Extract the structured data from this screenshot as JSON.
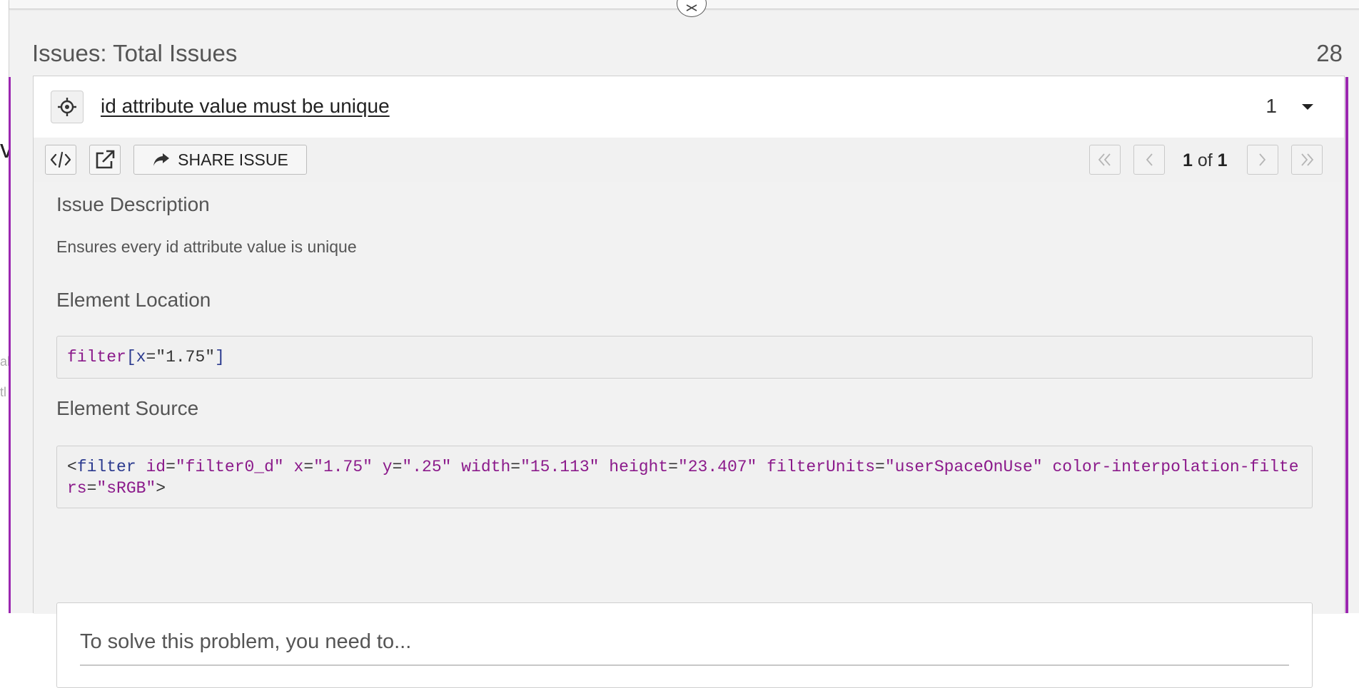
{
  "background": {
    "fragment_large": "vi",
    "fragment_small_1": "al",
    "fragment_small_2": "tl"
  },
  "panel": {
    "close_icon": "close-icon",
    "title": "Issues: Total Issues",
    "total_count": "28"
  },
  "issue": {
    "title": "id attribute value must be unique",
    "count": "1",
    "target_icon": "crosshair-icon",
    "caret_icon": "caret-down-icon"
  },
  "toolbar": {
    "code_icon": "code-icon",
    "open_icon": "external-link-icon",
    "share_icon": "share-arrow-icon",
    "share_label": "SHARE ISSUE",
    "pagination": {
      "current": "1",
      "of_label": "of",
      "total": "1",
      "first_icon": "double-chevron-left-icon",
      "prev_icon": "chevron-left-icon",
      "next_icon": "chevron-right-icon",
      "last_icon": "double-chevron-right-icon"
    }
  },
  "details": {
    "description_heading": "Issue Description",
    "description_text": "Ensures every id attribute value is unique",
    "location_heading": "Element Location",
    "location_code": {
      "tag": "filter",
      "open": "[",
      "attr": "x",
      "eq": "=",
      "value": "\"1.75\"",
      "close": "]"
    },
    "source_heading": "Element Source",
    "source_code": {
      "lt": "<",
      "tag": "filter",
      "attrs": [
        {
          "name": "id",
          "value": "\"filter0_d\""
        },
        {
          "name": "x",
          "value": "\"1.75\""
        },
        {
          "name": "y",
          "value": "\".25\""
        },
        {
          "name": "width",
          "value": "\"15.113\""
        },
        {
          "name": "height",
          "value": "\"23.407\""
        },
        {
          "name": "filterUnits",
          "value": "\"userSpaceOnUse\""
        },
        {
          "name": "color-interpolation-filters",
          "value": "\"sRGB\""
        }
      ],
      "gt": ">"
    },
    "solve_heading": "To solve this problem, you need to..."
  },
  "colors": {
    "accent_purple": "#9b27b0",
    "tag_blue": "#2c3b8f",
    "attr_purple": "#8b1a8b"
  }
}
